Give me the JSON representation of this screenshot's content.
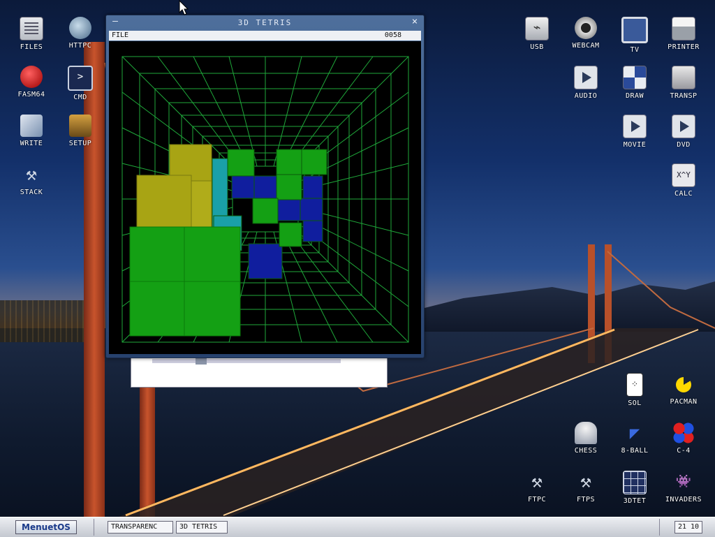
{
  "desktop": {
    "left_icons": [
      {
        "label": "FILES",
        "icon": "files-icon"
      },
      {
        "label": "HTTPC",
        "icon": "globe-icon"
      },
      {
        "label": "FASM64",
        "icon": "fasm-icon"
      },
      {
        "label": "CMD",
        "icon": "terminal-icon"
      },
      {
        "label": "WRITE",
        "icon": "pen-icon"
      },
      {
        "label": "SETUP",
        "icon": "chip-icon"
      },
      {
        "label": "STACK",
        "icon": "tools-icon"
      }
    ],
    "right_icons": [
      {
        "label": "USB",
        "icon": "usb-icon"
      },
      {
        "label": "WEBCAM",
        "icon": "webcam-icon"
      },
      {
        "label": "TV",
        "icon": "tv-icon"
      },
      {
        "label": "PRINTER",
        "icon": "printer-icon"
      },
      {
        "label": "AUDIO",
        "icon": "play-icon"
      },
      {
        "label": "DRAW",
        "icon": "draw-icon"
      },
      {
        "label": "TRANSP",
        "icon": "transparency-icon"
      },
      {
        "label": "MOVIE",
        "icon": "movie-icon"
      },
      {
        "label": "DVD",
        "icon": "dvd-icon"
      },
      {
        "label": "CALC",
        "icon": "calculator-icon",
        "glyph": "X^Y"
      },
      {
        "label": "SOL",
        "icon": "card-icon"
      },
      {
        "label": "PACMAN",
        "icon": "pacman-icon"
      },
      {
        "label": "CHESS",
        "icon": "chess-knight-icon"
      },
      {
        "label": "8-BALL",
        "icon": "billiard-icon"
      },
      {
        "label": "C-4",
        "icon": "connect-four-icon"
      },
      {
        "label": "FTPC",
        "icon": "tools-icon"
      },
      {
        "label": "FTPS",
        "icon": "tools-icon"
      },
      {
        "label": "3DTET",
        "icon": "grid-icon"
      },
      {
        "label": "INVADERS",
        "icon": "invaders-icon"
      }
    ]
  },
  "window": {
    "title": "3D TETRIS",
    "menu_file": "FILE",
    "score": "0058",
    "close_glyph": "×",
    "minimize_glyph": "—"
  },
  "taskbar": {
    "start_label": "MenuetOS",
    "tasks": [
      "TRANSPARENC",
      "3D TETRIS"
    ],
    "clock": "21 10"
  },
  "colors": {
    "grid": "#1fa83a",
    "green_block": "#14a014",
    "yellow_block": "#a8a414",
    "blue_block": "#101e9e",
    "cyan_block": "#1aa0a8"
  }
}
